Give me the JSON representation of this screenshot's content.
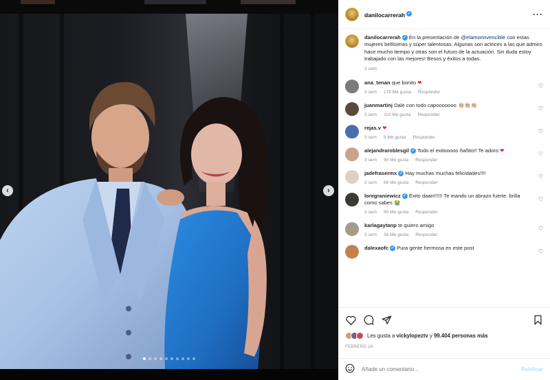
{
  "colors": {
    "verified": "#3897f0",
    "link": "#00376b",
    "muted": "#8e8e8e",
    "post_disabled": "#b2dffc",
    "heart_red": "#ed1b3a"
  },
  "carousel": {
    "slide_count": 10,
    "active_index": 0,
    "prev_icon": "chevron-left-icon",
    "next_icon": "chevron-right-icon"
  },
  "header": {
    "username": "danilocarrerah",
    "more_icon": "more-horizontal-icon"
  },
  "caption": {
    "username": "danilocarrerah",
    "text_before": "En la presentación de ",
    "mention": "@elamorinvencible",
    "text_after": " con estas mujeres bellísimas y súper talentosas. Algunas son actrices a las que admiro hace mucho tiempo y otras son el futuro de la actuación. Sin duda estoy trabajado con las mejores! Besos y éxitos a todas.",
    "time": "3 sem"
  },
  "comments": [
    {
      "user": "ana_tenan",
      "verified": false,
      "text": "que bonito ",
      "emoji": "❤",
      "emoji_red": true,
      "time": "3 sem",
      "likes": "178 Me gusta",
      "reply": "Responder",
      "avatar_color": "#7a7a7a"
    },
    {
      "user": "juanmartinj",
      "verified": false,
      "text": "Dale con todo capooooooo ",
      "emoji": "👏🏼👏🏼👏🏼",
      "emoji_red": false,
      "time": "3 sem",
      "likes": "110 Me gusta",
      "reply": "Responder",
      "avatar_color": "#5b4a3c"
    },
    {
      "user": "rejas.v",
      "verified": false,
      "text": "",
      "emoji": "❤",
      "emoji_red": true,
      "time": "3 sem",
      "likes": "5 Me gusta",
      "reply": "Responder",
      "avatar_color": "#4a6fb0"
    },
    {
      "user": "alejandraroblesgil",
      "verified": true,
      "text": "Todo el exitooooo ñañito!! Te adoro ",
      "emoji": "❤",
      "emoji_red": true,
      "time": "3 sem",
      "likes": "90 Me gusta",
      "reply": "Responder",
      "avatar_color": "#c9a38a"
    },
    {
      "user": "jadefrasermx",
      "verified": true,
      "text": "Hay muchas muchas felicidades!!!!",
      "emoji": "",
      "emoji_red": false,
      "time": "3 sem",
      "likes": "66 Me gusta",
      "reply": "Responder",
      "avatar_color": "#d9d2c8"
    },
    {
      "user": "loregraniewicz",
      "verified": true,
      "text": "Éxito daan!!!!!! Te mando un abrazo fuerte. brilla como sabes ",
      "emoji": "😭",
      "emoji_red": false,
      "time": "3 sem",
      "likes": "90 Me gusta",
      "reply": "Responder",
      "avatar_color": "#3c3a36"
    },
    {
      "user": "karlagaytanp",
      "verified": false,
      "text": "te quiero amigo",
      "emoji": "",
      "emoji_red": false,
      "time": "3 sem",
      "likes": "38 Me gusta",
      "reply": "Responder",
      "avatar_color": "#a89a88"
    },
    {
      "user": "dalexaofc",
      "verified": true,
      "text": "Pura gente hermosa en este post",
      "emoji": "",
      "emoji_red": false,
      "time": "",
      "likes": "",
      "reply": "",
      "avatar_color": "#c4824a"
    }
  ],
  "actions": {
    "like_icon": "heart-icon",
    "comment_icon": "comment-icon",
    "share_icon": "send-icon",
    "save_icon": "bookmark-icon"
  },
  "likes": {
    "prefix": "Les gusta a ",
    "user": "vickylopeztv",
    "middle": " y ",
    "count": "99.404 personas más"
  },
  "date": "FEBRERO 16",
  "add_comment": {
    "emoji_icon": "smiley-icon",
    "placeholder": "Añade un comentario...",
    "post_label": "Publicar"
  }
}
